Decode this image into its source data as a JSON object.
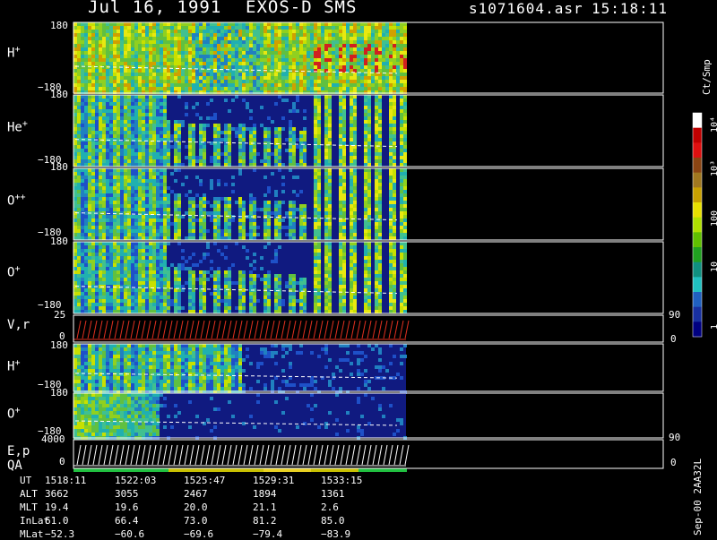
{
  "header": {
    "date": "Jul 16, 1991",
    "instrument": "EXOS-D SMS",
    "file": "s1071604.asr",
    "time": "15:18:11"
  },
  "panels": [
    {
      "id": "h-plus-1",
      "label": "H",
      "sup": "+",
      "ymax": "180",
      "ymin": "−180"
    },
    {
      "id": "he-plus",
      "label": "He",
      "sup": "+",
      "ymax": "180",
      "ymin": "−180"
    },
    {
      "id": "o-plusplus",
      "label": "O",
      "sup": "++",
      "ymax": "180",
      "ymin": "−180"
    },
    {
      "id": "o-plus-1",
      "label": "O",
      "sup": "+",
      "ymax": "180",
      "ymin": "−180"
    },
    {
      "id": "vr",
      "label": "V,r",
      "sup": "",
      "ymax": "25",
      "ymin": "0",
      "rmax": "90",
      "rmin": "0"
    },
    {
      "id": "h-plus-2",
      "label": "H",
      "sup": "+",
      "ymax": "180",
      "ymin": "−180"
    },
    {
      "id": "o-plus-2",
      "label": "O",
      "sup": "+",
      "ymax": "180",
      "ymin": "−180"
    },
    {
      "id": "ep",
      "label": "E,p",
      "label2": "QA",
      "sup": "",
      "ymax": "4000",
      "ymin": "0",
      "rmax": "90",
      "rmin": "0"
    }
  ],
  "colorbar": {
    "unit": "Ct/Smp",
    "ticks": [
      "10⁴",
      "10³",
      "100",
      "10",
      "1"
    ],
    "colors": [
      "#ffffff",
      "#c00000",
      "#e01010",
      "#8b4513",
      "#a07820",
      "#c8a000",
      "#e8e000",
      "#b0e000",
      "#60c000",
      "#20a020",
      "#109080",
      "#20c0c0",
      "#2060c0",
      "#1830a0",
      "#000080"
    ]
  },
  "footer": {
    "rows": [
      {
        "label": "UT",
        "values": [
          "1518:11",
          "1522:03",
          "1525:47",
          "1529:31",
          "1533:15"
        ]
      },
      {
        "label": "ALT",
        "values": [
          "3662",
          "3055",
          "2467",
          "1894",
          "1361"
        ]
      },
      {
        "label": "MLT",
        "values": [
          "19.4",
          "19.6",
          "20.0",
          "21.1",
          "2.6"
        ]
      },
      {
        "label": "InLat",
        "values": [
          "61.0",
          "66.4",
          "73.0",
          "81.2",
          "85.0"
        ]
      },
      {
        "label": "MLat",
        "values": [
          "−52.3",
          "−60.6",
          "−69.6",
          "−79.4",
          "−83.9"
        ]
      }
    ],
    "version": "Sep-00 2AA32L"
  },
  "chart_data": {
    "type": "heatmap",
    "title": "Jul 16, 1991   EXOS-D SMS",
    "x_ticks": [
      "1518:11",
      "1522:03",
      "1525:47",
      "1529:31",
      "1533:15"
    ],
    "series": [
      {
        "name": "H+",
        "ylim": [
          -180,
          180
        ]
      },
      {
        "name": "He+",
        "ylim": [
          -180,
          180
        ]
      },
      {
        "name": "O++",
        "ylim": [
          -180,
          180
        ]
      },
      {
        "name": "O+",
        "ylim": [
          -180,
          180
        ]
      },
      {
        "name": "V,r",
        "ylim": [
          0,
          25
        ]
      },
      {
        "name": "H+",
        "ylim": [
          -180,
          180
        ]
      },
      {
        "name": "O+",
        "ylim": [
          -180,
          180
        ]
      },
      {
        "name": "E,p",
        "ylim": [
          0,
          4000
        ]
      }
    ],
    "color_scale": {
      "label": "Ct/Smp",
      "log": true,
      "range": [
        1,
        10000
      ]
    }
  }
}
